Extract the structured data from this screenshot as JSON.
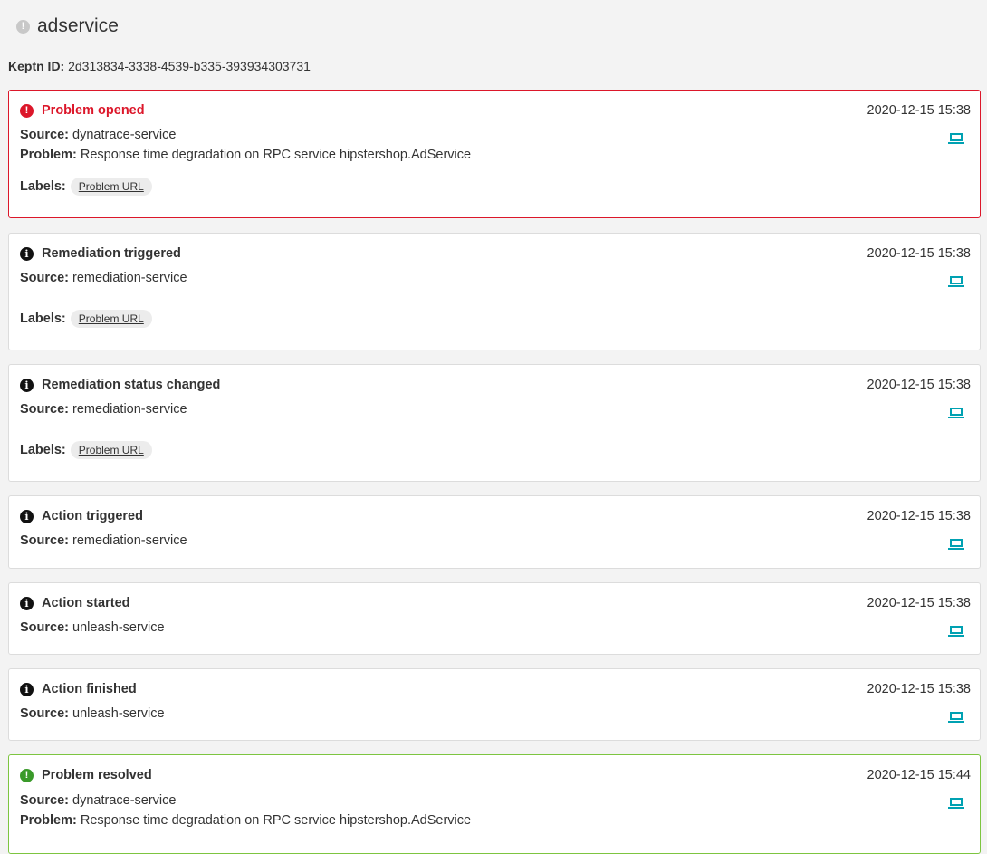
{
  "header": {
    "title": "adservice"
  },
  "keptn": {
    "label": "Keptn ID:",
    "value": "2d313834-3338-4539-b335-393934303731"
  },
  "labels_label": "Labels:",
  "source_label": "Source:",
  "problem_label": "Problem:",
  "events": [
    {
      "title": "Problem opened",
      "time": "2020-12-15 15:38",
      "source": "dynatrace-service",
      "problem": "Response time degradation on RPC service hipstershop.AdService",
      "label": "Problem URL"
    },
    {
      "title": "Remediation triggered",
      "time": "2020-12-15 15:38",
      "source": "remediation-service",
      "label": "Problem URL"
    },
    {
      "title": "Remediation status changed",
      "time": "2020-12-15 15:38",
      "source": "remediation-service",
      "label": "Problem URL"
    },
    {
      "title": "Action triggered",
      "time": "2020-12-15 15:38",
      "source": "remediation-service"
    },
    {
      "title": "Action started",
      "time": "2020-12-15 15:38",
      "source": "unleash-service"
    },
    {
      "title": "Action finished",
      "time": "2020-12-15 15:38",
      "source": "unleash-service"
    },
    {
      "title": "Problem resolved",
      "time": "2020-12-15 15:44",
      "source": "dynatrace-service",
      "problem": "Response time degradation on RPC service hipstershop.AdService"
    }
  ],
  "colors": {
    "error": "#dc172a",
    "success": "#7dc540",
    "info": "#111111",
    "accent": "#00a1b2"
  }
}
